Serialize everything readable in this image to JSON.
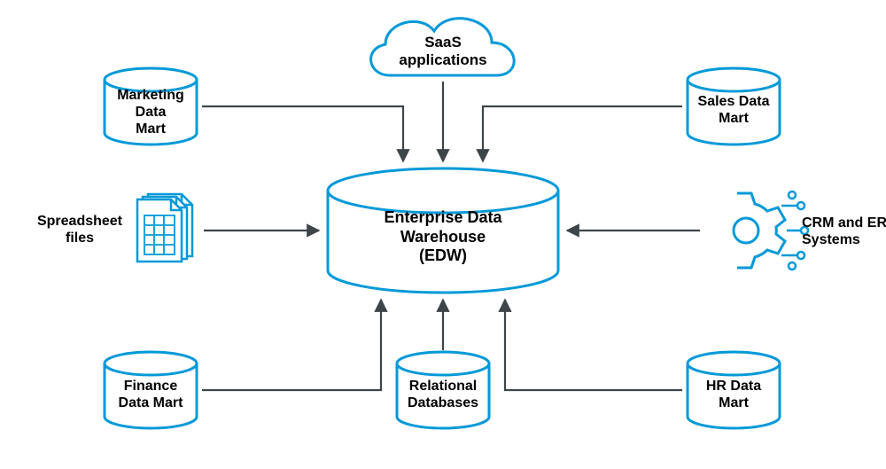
{
  "diagram": {
    "center": {
      "title_line1": "Enterprise Data",
      "title_line2": "Warehouse",
      "title_line3": "(EDW)"
    },
    "nodes": {
      "saas": {
        "line1": "SaaS",
        "line2": "applications"
      },
      "marketing": {
        "line1": "Marketing",
        "line2": "Data",
        "line3": "Mart"
      },
      "sales": {
        "line1": "Sales Data",
        "line2": "Mart"
      },
      "spreadsheet": {
        "line1": "Spreadsheet",
        "line2": "files"
      },
      "crm": {
        "line1": "CRM and ERP",
        "line2": "Systems"
      },
      "finance": {
        "line1": "Finance",
        "line2": "Data Mart"
      },
      "relational": {
        "line1": "Relational",
        "line2": "Databases"
      },
      "hr": {
        "line1": "HR Data",
        "line2": "Mart"
      }
    }
  },
  "colors": {
    "brand": "#0099d8",
    "arrow": "#3d4549"
  }
}
